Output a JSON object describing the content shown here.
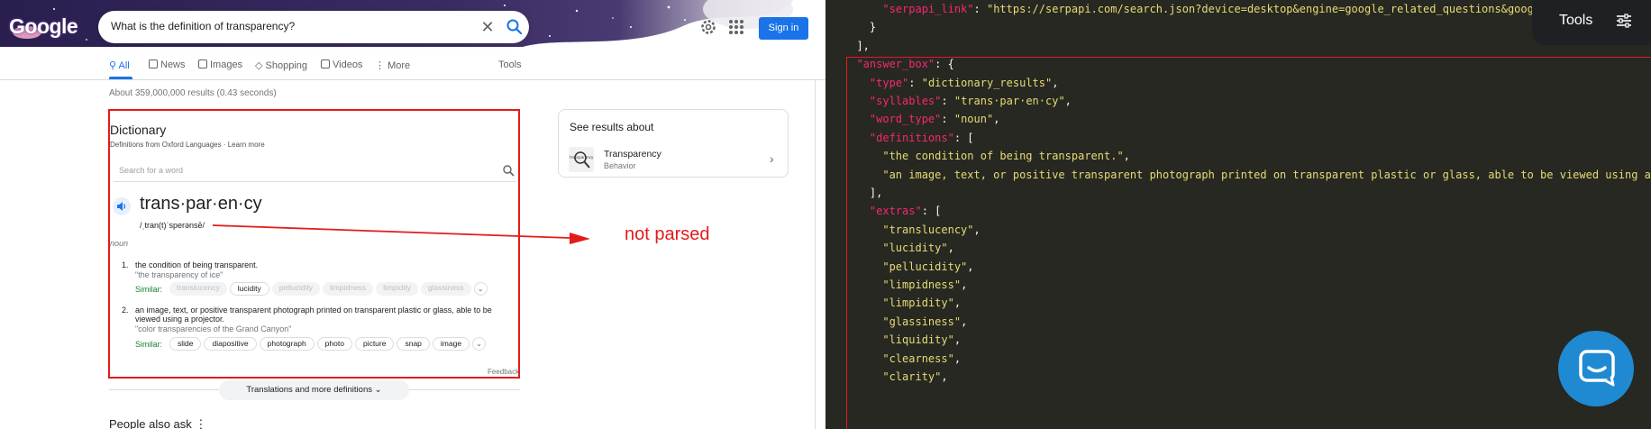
{
  "serp": {
    "logo": "Google",
    "search_query": "What is the definition of transparency?",
    "signin_label": "Sign in",
    "tabs": [
      "All",
      "News",
      "Images",
      "Shopping",
      "Videos",
      "More",
      "Tools"
    ],
    "result_stats": "About 359,000,000 results (0.43 seconds)",
    "dictionary": {
      "title": "Dictionary",
      "source": "Definitions from Oxford Languages · Learn more",
      "word_search_placeholder": "Search for a word",
      "headword": "trans·par·en·cy",
      "phonetic": "/ˌtran(t)ˈsperənsē/",
      "part_of_speech": "noun",
      "definitions": [
        {
          "num": "1.",
          "text": "the condition of being transparent.",
          "example": "\"the transparency of ice\"",
          "similar_label": "Similar:",
          "similar": [
            "translucency",
            "lucidity",
            "pellucidity",
            "limpidness",
            "limpidity",
            "glassiness"
          ]
        },
        {
          "num": "2.",
          "text": "an image, text, or positive transparent photograph printed on transparent plastic or glass, able to be viewed using a projector.",
          "example": "\"color transparencies of the Grand Canyon\"",
          "similar_label": "Similar:",
          "similar": [
            "slide",
            "diapositive",
            "photograph",
            "photo",
            "picture",
            "snap",
            "image"
          ]
        }
      ],
      "feedback": "Feedback"
    },
    "translations_button": "Translations and more definitions",
    "people_also_ask": "People also ask",
    "see_results": {
      "title": "See results about",
      "name": "Transparency",
      "subtitle": "Behavior",
      "thumb_text": "transparency"
    },
    "annotation": "not parsed"
  },
  "code": {
    "lines": [
      [
        [
          "p",
          "      "
        ],
        [
          "k",
          "\"serpapi_link\""
        ],
        [
          "p",
          ": "
        ],
        [
          "s",
          "\"https://serpapi.com/search.json?device=desktop&engine=google_related_questions&google_d"
        ]
      ],
      [
        [
          "p",
          "    }"
        ]
      ],
      [
        [
          "p",
          "  ],"
        ]
      ],
      [
        [
          "k",
          "  \"answer_box\""
        ],
        [
          "p",
          ": {"
        ]
      ],
      [
        [
          "p",
          "    "
        ],
        [
          "k",
          "\"type\""
        ],
        [
          "p",
          ": "
        ],
        [
          "s",
          "\"dictionary_results\""
        ],
        [
          "p",
          ","
        ]
      ],
      [
        [
          "p",
          "    "
        ],
        [
          "k",
          "\"syllables\""
        ],
        [
          "p",
          ": "
        ],
        [
          "s",
          "\"trans·par·en·cy\""
        ],
        [
          "p",
          ","
        ]
      ],
      [
        [
          "p",
          "    "
        ],
        [
          "k",
          "\"word_type\""
        ],
        [
          "p",
          ": "
        ],
        [
          "s",
          "\"noun\""
        ],
        [
          "p",
          ","
        ]
      ],
      [
        [
          "p",
          "    "
        ],
        [
          "k",
          "\"definitions\""
        ],
        [
          "p",
          ": ["
        ]
      ],
      [
        [
          "p",
          "      "
        ],
        [
          "s",
          "\"the condition of being transparent.\""
        ],
        [
          "p",
          ","
        ]
      ],
      [
        [
          "p",
          "      "
        ],
        [
          "s",
          "\"an image, text, or positive transparent photograph printed on transparent plastic or glass, able to be viewed using a proj"
        ]
      ],
      [
        [
          "p",
          "    ],"
        ]
      ],
      [
        [
          "p",
          "    "
        ],
        [
          "k",
          "\"extras\""
        ],
        [
          "p",
          ": ["
        ]
      ],
      [
        [
          "p",
          "      "
        ],
        [
          "s",
          "\"translucency\""
        ],
        [
          "p",
          ","
        ]
      ],
      [
        [
          "p",
          "      "
        ],
        [
          "s",
          "\"lucidity\""
        ],
        [
          "p",
          ","
        ]
      ],
      [
        [
          "p",
          "      "
        ],
        [
          "s",
          "\"pellucidity\""
        ],
        [
          "p",
          ","
        ]
      ],
      [
        [
          "p",
          "      "
        ],
        [
          "s",
          "\"limpidness\""
        ],
        [
          "p",
          ","
        ]
      ],
      [
        [
          "p",
          "      "
        ],
        [
          "s",
          "\"limpidity\""
        ],
        [
          "p",
          ","
        ]
      ],
      [
        [
          "p",
          "      "
        ],
        [
          "s",
          "\"glassiness\""
        ],
        [
          "p",
          ","
        ]
      ],
      [
        [
          "p",
          "      "
        ],
        [
          "s",
          "\"liquidity\""
        ],
        [
          "p",
          ","
        ]
      ],
      [
        [
          "p",
          "      "
        ],
        [
          "s",
          "\"clearness\""
        ],
        [
          "p",
          ","
        ]
      ],
      [
        [
          "p",
          "      "
        ],
        [
          "s",
          "\"clarity\""
        ],
        [
          "p",
          ","
        ]
      ]
    ],
    "tools_label": "Tools"
  },
  "colors": {
    "google_blue": "#1a73e8",
    "annotation_red": "#e41b1b",
    "similar_green": "#188038",
    "code_bg": "#272822",
    "json_key": "#f92672",
    "json_string": "#e6db74"
  }
}
